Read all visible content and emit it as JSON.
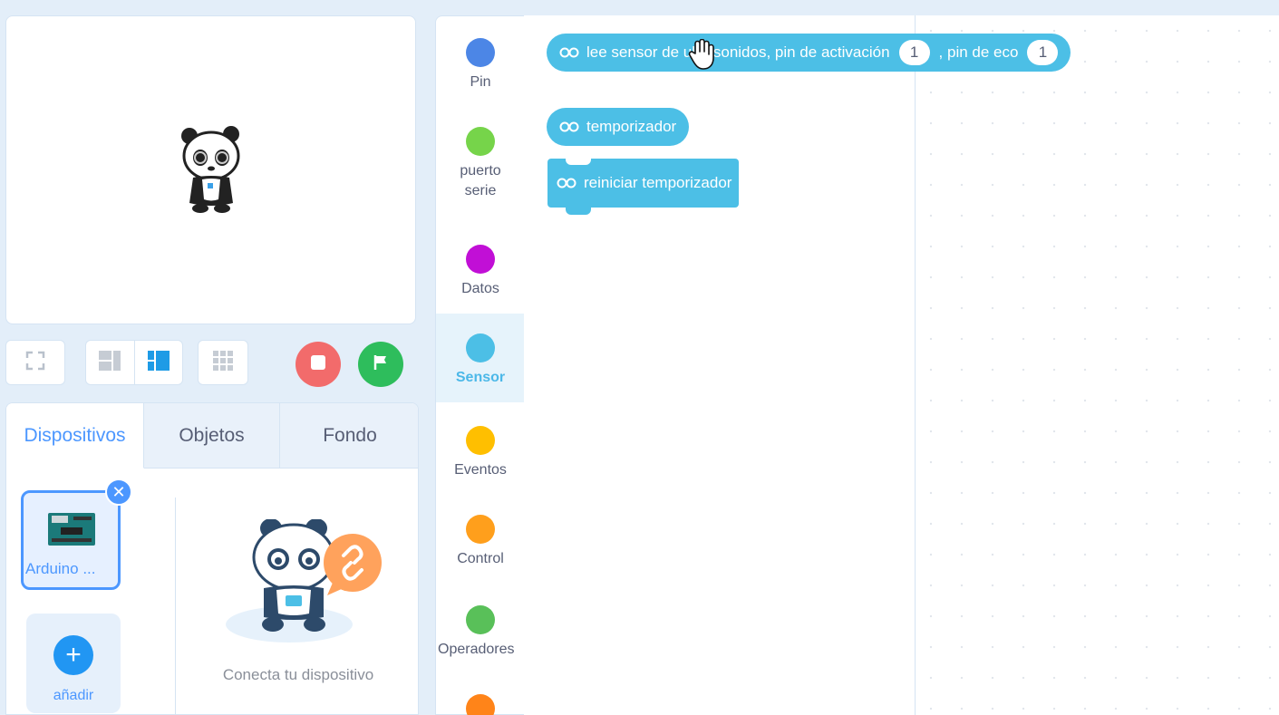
{
  "stage": {
    "sprite_name": "panda-sprite"
  },
  "toolbar": {
    "fullscreen": "fullscreen-icon",
    "layout_small": "layout-small-stage-icon",
    "layout_large": "layout-large-stage-icon",
    "grid": "grid-icon",
    "stop": "stop-icon",
    "go": "green-flag-icon"
  },
  "tabs": [
    {
      "label": "Dispositivos",
      "active": true
    },
    {
      "label": "Objetos",
      "active": false
    },
    {
      "label": "Fondo",
      "active": false
    }
  ],
  "devices": {
    "selected_label": "Arduino ...",
    "add_label": "añadir",
    "connect_text": "Conecta tu dispositivo"
  },
  "categories": [
    {
      "label": "Pin",
      "color": "#4c86e6"
    },
    {
      "label": "puerto serie",
      "color": "#76d44a"
    },
    {
      "label": "Datos",
      "color": "#c10fd6"
    },
    {
      "label": "Sensor",
      "color": "#4cbfe6",
      "active": true
    },
    {
      "label": "Eventos",
      "color": "#ffbf00"
    },
    {
      "label": "Control",
      "color": "#ff9f1c"
    },
    {
      "label": "Operadores",
      "color": "#59c059"
    },
    {
      "label": "",
      "color": "#ff8419"
    }
  ],
  "blocks": {
    "ultrasonic": {
      "text_a": "lee sensor de ultrasonidos, pin de activación",
      "trig_value": "1",
      "text_b": ", pin de eco",
      "echo_value": "1"
    },
    "timer": "temporizador",
    "reset_timer": "reiniciar temporizador"
  },
  "colors": {
    "sensor_block": "#4cbfe6",
    "accent": "#4c97ff"
  }
}
